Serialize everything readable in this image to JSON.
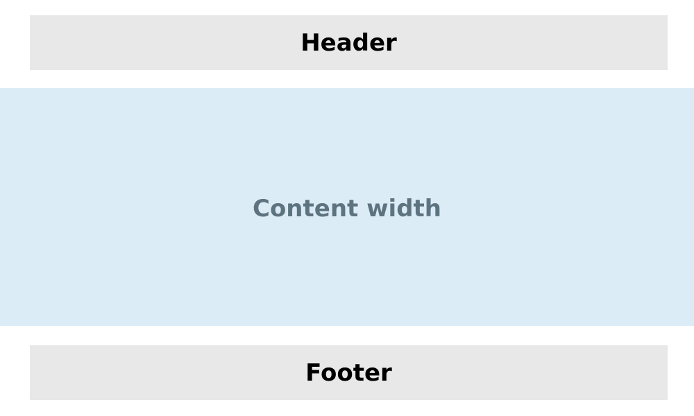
{
  "header": {
    "label": "Header"
  },
  "content": {
    "label": "Content width"
  },
  "footer": {
    "label": "Footer"
  },
  "colors": {
    "page_background": "#ffffff",
    "bar_background": "#e8e8e8",
    "bar_text": "#000000",
    "content_background": "#dcecf6",
    "content_text": "#5d7480"
  }
}
